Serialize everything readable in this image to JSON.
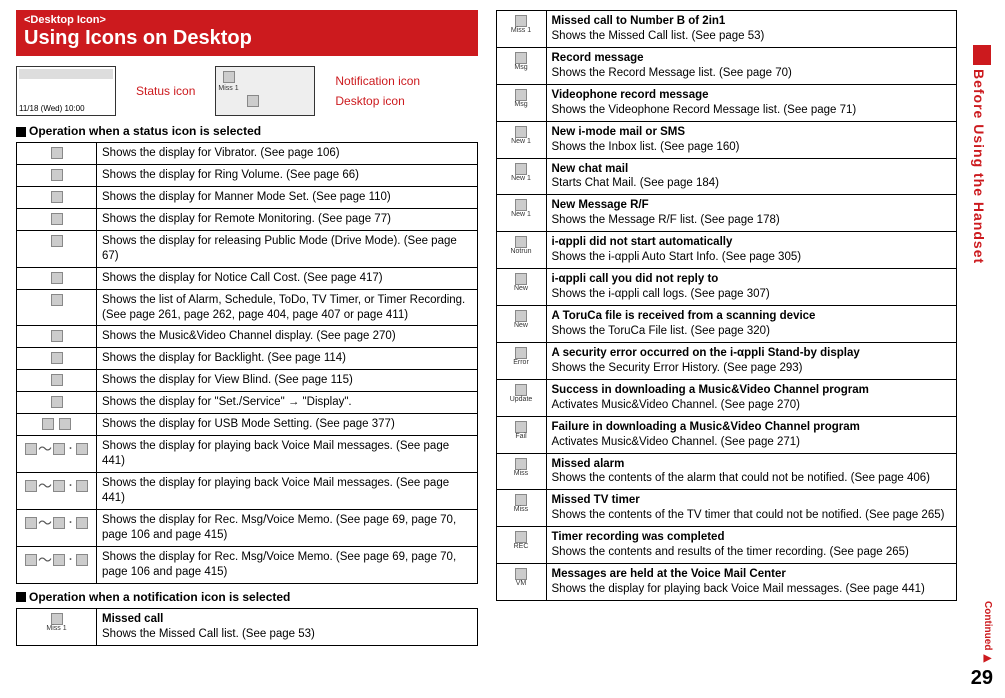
{
  "titlebar": {
    "category": "<Desktop Icon>",
    "title": "Using Icons on Desktop"
  },
  "illustration": {
    "status_icon": "Status icon",
    "notification_icon": "Notification icon",
    "desktop_icon": "Desktop icon",
    "screen_time": "11/18 (Wed) 10:00",
    "miss_label": "Miss 1"
  },
  "section1_head": "Operation when a status icon is selected",
  "section2_head": "Operation when a notification icon is selected",
  "status_rows": [
    "Shows the display for Vibrator. (See page 106)",
    "Shows the display for Ring Volume. (See page 66)",
    "Shows the display for Manner Mode Set. (See page 110)",
    "Shows the display for Remote Monitoring. (See page 77)",
    "Shows the display for releasing Public Mode (Drive Mode). (See page 67)",
    "Shows the display for Notice Call Cost. (See page 417)",
    "Shows the list of Alarm, Schedule, ToDo, TV Timer, or Timer Recording. (See page 261, page 262, page 404, page 407 or page 411)",
    "Shows the Music&Video Channel display. (See page 270)",
    "Shows the display for Backlight. (See page 114)",
    "Shows the display for View Blind. (See page 115)",
    "Shows the display for \"Set./Service\" → \"Display\".",
    "Shows the display for USB Mode Setting. (See page 377)",
    "Shows the display for playing back Voice Mail messages. (See page 441)",
    "Shows the display for playing back Voice Mail messages. (See page 441)",
    "Shows the display for Rec. Msg/Voice Memo. (See page 69, page 70, page 106 and page 415)",
    "Shows the display for Rec. Msg/Voice Memo. (See page 69, page 70, page 106 and page 415)"
  ],
  "notif_left": [
    {
      "title": "Missed call",
      "desc": "Shows the Missed Call list. (See page 53)",
      "il": "Miss 1"
    }
  ],
  "notif_right": [
    {
      "title": "Missed call to Number B of 2in1",
      "desc": "Shows the Missed Call list. (See page 53)",
      "il": "Miss 1"
    },
    {
      "title": "Record message",
      "desc": "Shows the Record Message list. (See page 70)",
      "il": "Msg"
    },
    {
      "title": "Videophone record message",
      "desc": "Shows the Videophone Record Message list. (See page 71)",
      "il": "Msg"
    },
    {
      "title": "New i-mode mail or SMS",
      "desc": "Shows the Inbox list. (See page 160)",
      "il": "New 1"
    },
    {
      "title": "New chat mail",
      "desc": "Starts Chat Mail. (See page 184)",
      "il": "New 1"
    },
    {
      "title": "New Message R/F",
      "desc": "Shows the Message R/F list. (See page 178)",
      "il": "New 1"
    },
    {
      "title": "i-αppli did not start automatically",
      "desc": "Shows the i-αppli Auto Start Info. (See page 305)",
      "il": "Notrun"
    },
    {
      "title": "i-αppli call you did not reply to",
      "desc": "Shows the i-αppli call logs. (See page 307)",
      "il": "New"
    },
    {
      "title": "A ToruCa file is received from a scanning device",
      "desc": "Shows the ToruCa File list. (See page 320)",
      "il": "New"
    },
    {
      "title": "A security error occurred on the i-αppli Stand-by display",
      "desc": "Shows the Security Error History. (See page 293)",
      "il": "Error"
    },
    {
      "title": "Success in downloading a Music&Video Channel program",
      "desc": "Activates Music&Video Channel. (See page 270)",
      "il": "Update"
    },
    {
      "title": "Failure in downloading a Music&Video Channel program",
      "desc": "Activates Music&Video Channel. (See page 271)",
      "il": "Fail"
    },
    {
      "title": "Missed alarm",
      "desc": "Shows the contents of the alarm that could not be notified. (See page 406)",
      "il": "Miss"
    },
    {
      "title": "Missed TV timer",
      "desc": "Shows the contents of the TV timer that could not be notified. (See page 265)",
      "il": "Miss"
    },
    {
      "title": "Timer recording was completed",
      "desc": "Shows the contents and results of the timer recording. (See page 265)",
      "il": "REC"
    },
    {
      "title": "Messages are held at the Voice Mail Center",
      "desc": "Shows the display for playing back Voice Mail messages. (See page 441)",
      "il": "VM"
    }
  ],
  "side_label": "Before Using the Handset",
  "continued": "Continued ▶",
  "page_number": "29"
}
